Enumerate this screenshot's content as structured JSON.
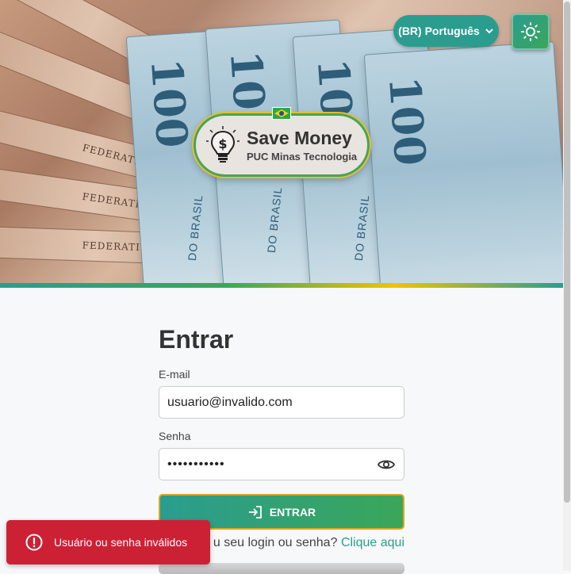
{
  "header": {
    "language_label": "(BR) Português",
    "theme_icon": "sun-icon",
    "flag_icon": "brazil-flag-icon"
  },
  "logo": {
    "title": "Save Money",
    "subtitle": "PUC Minas Tecnologia",
    "icon": "lightbulb-dollar-icon"
  },
  "background": {
    "bill_value": "100",
    "bill_text_1": "DO BRASIL",
    "bill_text_2": "FEDERATIVA DO BRASIL",
    "bill_text_3": "FEDERATIVA DO BRASIL"
  },
  "form": {
    "title": "Entrar",
    "email_label": "E-mail",
    "email_value": "usuario@invalido.com",
    "password_label": "Senha",
    "password_value": "•••••••••••",
    "submit_label": "ENTRAR",
    "forgot_text": "u seu login ou senha?",
    "forgot_link": "Clique aqui"
  },
  "toast": {
    "message": "Usuário ou senha inválidos",
    "icon": "error-circle-icon"
  },
  "colors": {
    "accent": "#2a9d8f",
    "accent_green": "#3aa65a",
    "error": "#cc2135"
  }
}
